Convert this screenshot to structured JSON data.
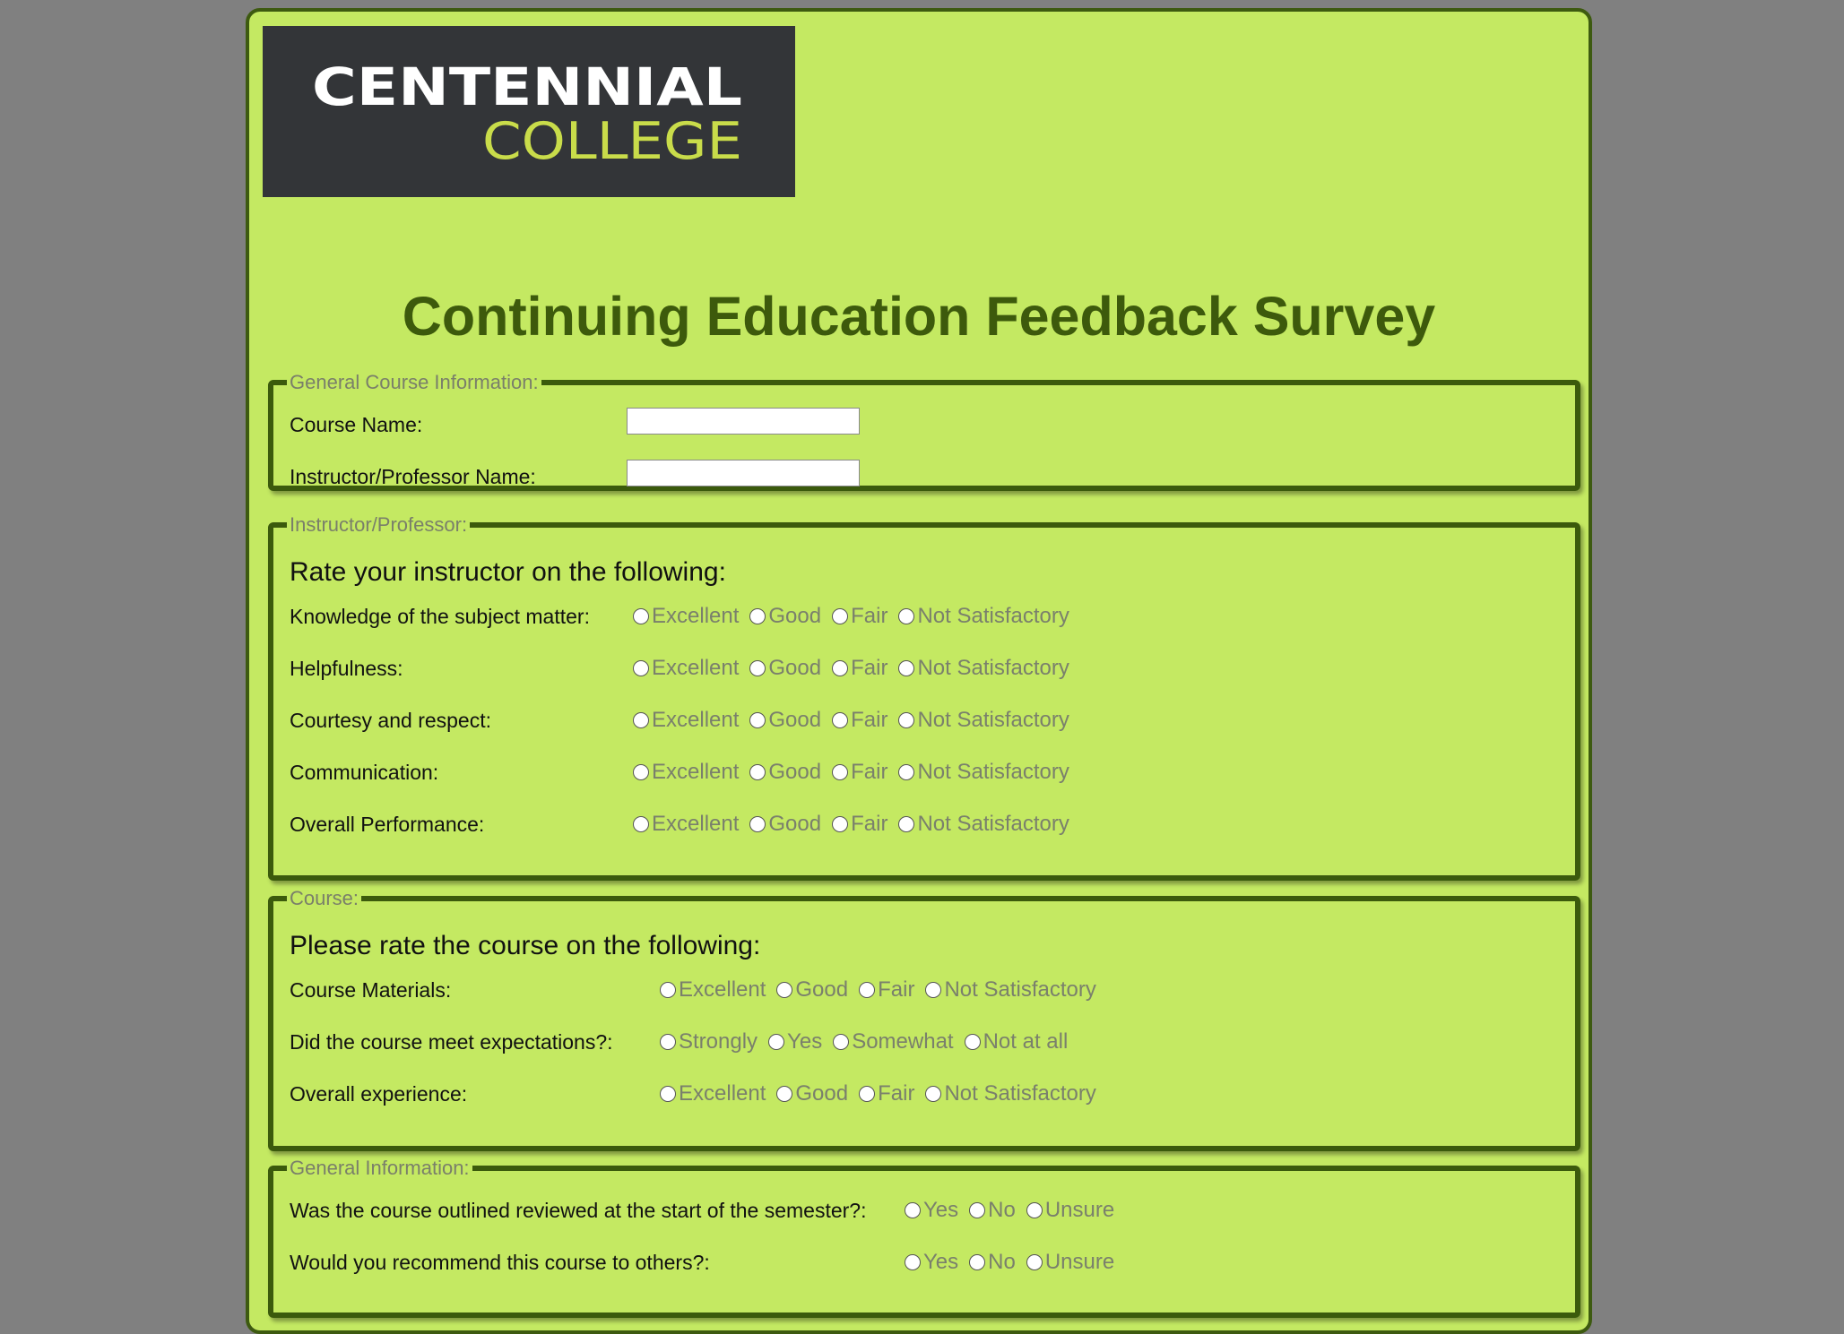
{
  "logo": {
    "line1": "CENTENNIAL",
    "line2": "COLLEGE",
    "bg": "#333538",
    "accent": "#c9dc4a"
  },
  "title": "Continuing Education Feedback Survey",
  "colors": {
    "page_bg": "#808080",
    "panel_bg": "#c4e962",
    "border": "#3b5a0c",
    "title": "#3d5a0c"
  },
  "general_course": {
    "legend": "General Course Information:",
    "course_name_label": "Course Name:",
    "course_name_value": "",
    "instructor_name_label": "Instructor/Professor Name:",
    "instructor_name_value": ""
  },
  "instructor": {
    "legend": "Instructor/Professor:",
    "subheading": "Rate your instructor on the following:",
    "options": [
      "Excellent",
      "Good",
      "Fair",
      "Not Satisfactory"
    ],
    "questions": [
      "Knowledge of the subject matter:",
      "Helpfulness:",
      "Courtesy and respect:",
      "Communication:",
      "Overall Performance:"
    ]
  },
  "course": {
    "legend": "Course:",
    "subheading": "Please rate the course on the following:",
    "questions": [
      {
        "label": "Course Materials:",
        "options": [
          "Excellent",
          "Good",
          "Fair",
          "Not Satisfactory"
        ]
      },
      {
        "label": "Did the course meet expectations?:",
        "options": [
          "Strongly",
          "Yes",
          "Somewhat",
          "Not at all"
        ]
      },
      {
        "label": "Overall experience:",
        "options": [
          "Excellent",
          "Good",
          "Fair",
          "Not Satisfactory"
        ]
      }
    ]
  },
  "general_info": {
    "legend": "General Information:",
    "options": [
      "Yes",
      "No",
      "Unsure"
    ],
    "questions": [
      "Was the course outlined reviewed at the start of the semester?:",
      "Would you recommend this course to others?:"
    ]
  }
}
